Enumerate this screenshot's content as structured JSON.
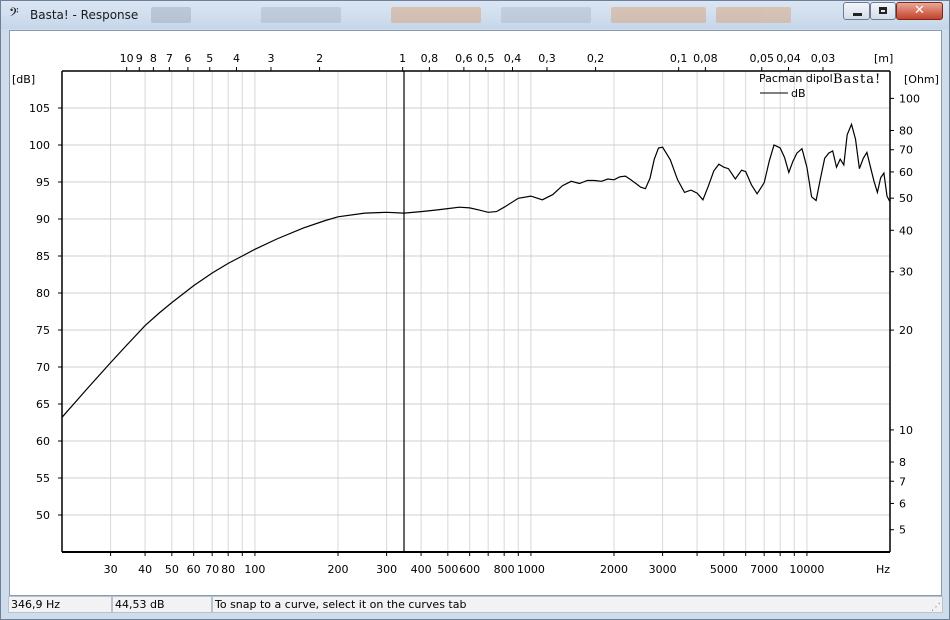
{
  "window": {
    "title": "Basta! - Response",
    "app_icon": "bass-clef-icon",
    "controls": {
      "minimize": "minimize-icon",
      "maximize": "maximize-icon",
      "close": "close-icon"
    }
  },
  "chart_data": {
    "type": "line",
    "x_scale": "log",
    "x_unit": "Hz",
    "xlim": [
      20,
      20000
    ],
    "x_ticks": [
      30,
      40,
      50,
      60,
      70,
      80,
      100,
      200,
      300,
      400,
      500,
      600,
      800,
      1000,
      2000,
      3000,
      5000,
      7000,
      10000
    ],
    "top_axis_unit": "[m]",
    "top_ticks": [
      "10",
      "9",
      "8",
      "7",
      "6",
      "5",
      "4",
      "3",
      "2",
      "1",
      "0,8",
      "0,6",
      "0,5",
      "0,4",
      "0,3",
      "0,2",
      "0,1",
      "0,08",
      "0,05",
      "0,04",
      "0,03"
    ],
    "left_axis_unit": "[dB]",
    "ylim": [
      45,
      110
    ],
    "y_ticks": [
      50,
      55,
      60,
      65,
      70,
      75,
      80,
      85,
      90,
      95,
      100,
      105
    ],
    "right_axis_unit": "[Ohm]",
    "right_scale": "log",
    "right_ticks": [
      5,
      6,
      7,
      8,
      10,
      20,
      30,
      40,
      50,
      60,
      70,
      80,
      100
    ],
    "grid": true,
    "legend_title": "Pacman dipol",
    "watermark": "Basta!",
    "cursor_x": 346.9,
    "series": [
      {
        "name": "dB",
        "color": "#000000",
        "x": [
          20,
          25,
          30,
          35,
          40,
          45,
          50,
          60,
          70,
          80,
          90,
          100,
          120,
          150,
          180,
          200,
          250,
          300,
          346.9,
          400,
          450,
          500,
          550,
          600,
          650,
          700,
          750,
          800,
          900,
          1000,
          1100,
          1200,
          1300,
          1400,
          1500,
          1600,
          1700,
          1800,
          1900,
          2000,
          2100,
          2200,
          2300,
          2400,
          2500,
          2600,
          2700,
          2800,
          2900,
          3000,
          3200,
          3400,
          3600,
          3800,
          4000,
          4200,
          4400,
          4600,
          4800,
          5000,
          5200,
          5500,
          5800,
          6000,
          6300,
          6600,
          7000,
          7300,
          7600,
          8000,
          8300,
          8600,
          8900,
          9200,
          9600,
          10000,
          10400,
          10800,
          11200,
          11600,
          12000,
          12400,
          12800,
          13200,
          13600,
          14000,
          14500,
          15000,
          15500,
          16000,
          16500,
          17000,
          17500,
          18000,
          18500,
          19000,
          19500,
          20000
        ],
        "y": [
          63.2,
          67.3,
          70.6,
          73.3,
          75.6,
          77.3,
          78.7,
          81.0,
          82.7,
          84.0,
          85.0,
          85.9,
          87.3,
          88.8,
          89.8,
          90.3,
          90.8,
          90.9,
          90.8,
          91.0,
          91.2,
          91.4,
          91.6,
          91.5,
          91.2,
          90.9,
          91.0,
          91.6,
          92.8,
          93.1,
          92.6,
          93.3,
          94.5,
          95.1,
          94.8,
          95.2,
          95.2,
          95.1,
          95.4,
          95.3,
          95.7,
          95.8,
          95.3,
          94.8,
          94.3,
          94.1,
          95.5,
          98.1,
          99.6,
          99.7,
          98.0,
          95.3,
          93.6,
          93.9,
          93.5,
          92.6,
          94.5,
          96.5,
          97.4,
          97.0,
          96.8,
          95.4,
          96.6,
          96.4,
          94.6,
          93.4,
          94.9,
          97.8,
          100.0,
          99.6,
          98.3,
          96.3,
          97.8,
          98.9,
          99.5,
          97.0,
          93.0,
          92.5,
          95.5,
          98.2,
          98.9,
          99.2,
          97.0,
          98.1,
          97.3,
          101.4,
          102.8,
          100.8,
          96.8,
          98.2,
          99.0,
          97.0,
          95.1,
          93.6,
          95.6,
          96.2,
          93.1,
          92.3
        ]
      }
    ]
  },
  "status": {
    "frequency": "346,9 Hz",
    "level": "44,53 dB",
    "hint": "To snap to a curve, select it on the curves tab"
  }
}
